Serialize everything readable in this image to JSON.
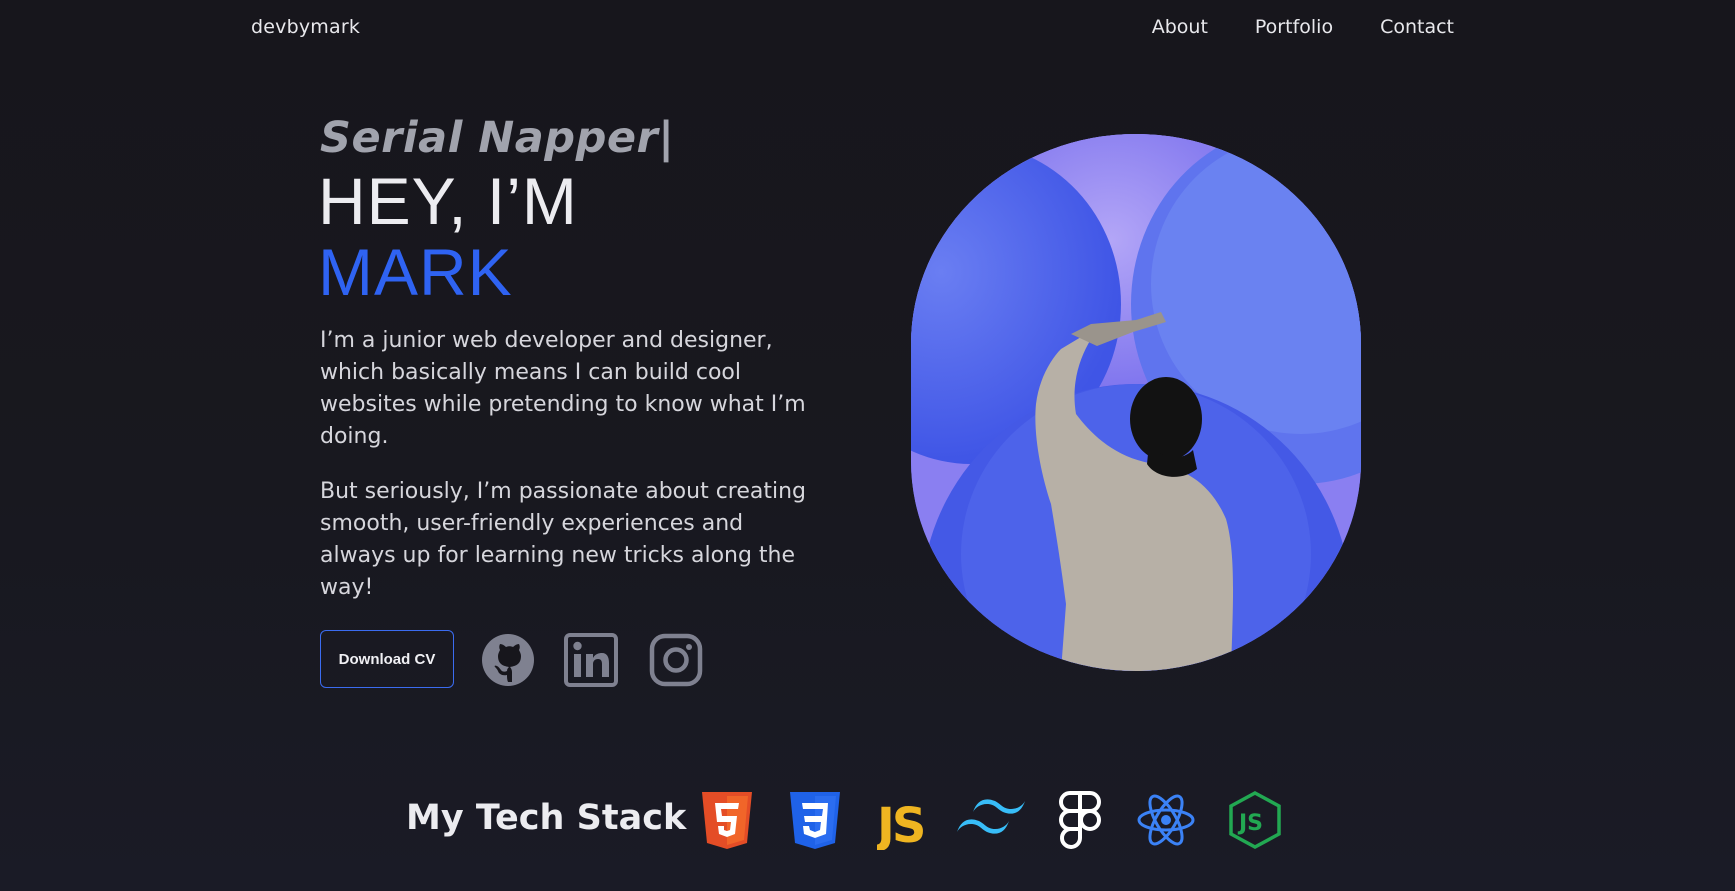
{
  "header": {
    "logo": "devbymark",
    "nav": [
      {
        "label": "About"
      },
      {
        "label": "Portfolio"
      },
      {
        "label": "Contact"
      }
    ]
  },
  "hero": {
    "tagline": "Serial Napper",
    "greeting": "HEY, I’M",
    "name": "MARK",
    "paragraphs": [
      "I’m a junior web developer and designer, which basically means I can build cool websites while pretending to know what I’m doing.",
      "But seriously, I’m passionate about creating smooth, user-friendly experiences and always up for learning new tricks along the way!"
    ],
    "cv_button": "Download CV",
    "socials": [
      {
        "icon": "github-icon"
      },
      {
        "icon": "linkedin-icon"
      },
      {
        "icon": "instagram-icon"
      }
    ]
  },
  "tech_stack": {
    "title": "My Tech Stack",
    "items": [
      {
        "icon": "html5-icon",
        "color": "#e44d26"
      },
      {
        "icon": "css3-icon",
        "color": "#1f62e8"
      },
      {
        "icon": "javascript-icon",
        "color": "#efb521"
      },
      {
        "icon": "tailwind-icon",
        "color": "#38bdf8"
      },
      {
        "icon": "figma-icon",
        "color": "#ffffff"
      },
      {
        "icon": "react-icon",
        "color": "#3b82f6"
      },
      {
        "icon": "nodejs-icon",
        "color": "#22a852"
      }
    ]
  },
  "colors": {
    "background": "#17161c",
    "accent": "#2f63f2",
    "muted": "#a1a3ad",
    "text": "#e5e5ea"
  }
}
